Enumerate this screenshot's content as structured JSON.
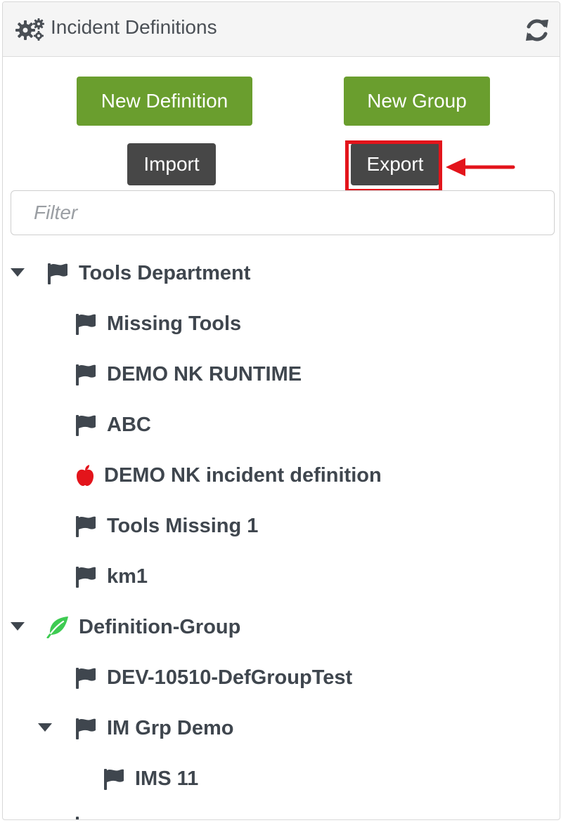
{
  "header": {
    "title": "Incident Definitions",
    "left_icon": "gears-icon",
    "right_icon": "refresh-icon"
  },
  "actions": {
    "new_definition": "New Definition",
    "new_group": "New Group",
    "import": "Import",
    "export": "Export"
  },
  "filter": {
    "placeholder": "Filter",
    "value": ""
  },
  "colors": {
    "primary_green": "#6a9e2e",
    "dark_button": "#474747",
    "highlight_red": "#e3141b",
    "apple_red": "#e3141b",
    "leaf_green": "#3ecb52",
    "tree_text": "#3f464e"
  },
  "tree": [
    {
      "label": "Tools Department",
      "icon": "flag-icon",
      "level": 0,
      "expanded": true
    },
    {
      "label": "Missing Tools",
      "icon": "flag-icon",
      "level": 1
    },
    {
      "label": "DEMO NK RUNTIME",
      "icon": "flag-icon",
      "level": 1
    },
    {
      "label": "ABC",
      "icon": "flag-icon",
      "level": 1
    },
    {
      "label": "DEMO NK incident definition",
      "icon": "apple-icon",
      "level": 1
    },
    {
      "label": "Tools Missing 1",
      "icon": "flag-icon",
      "level": 1
    },
    {
      "label": "km1",
      "icon": "flag-icon",
      "level": 1
    },
    {
      "label": "Definition-Group",
      "icon": "leaf-icon",
      "level": 0,
      "expanded": true
    },
    {
      "label": "DEV-10510-DefGroupTest",
      "icon": "flag-icon",
      "level": 1
    },
    {
      "label": "IM Grp Demo",
      "icon": "flag-icon",
      "level": 1,
      "expanded": true
    },
    {
      "label": "IMS 11",
      "icon": "flag-icon",
      "level": 2
    }
  ]
}
